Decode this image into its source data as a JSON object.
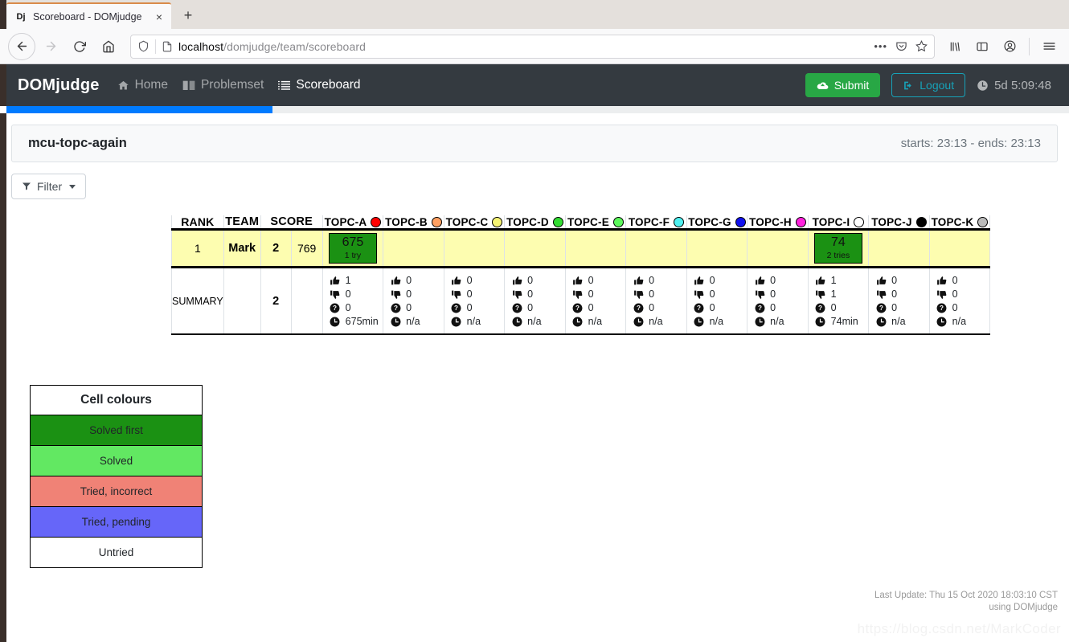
{
  "browser": {
    "tab": {
      "favicon_text": "Dj",
      "title": "Scoreboard - DOMjudge",
      "close_label": "×"
    },
    "new_tab_label": "+",
    "url_host": "localhost",
    "url_path": "/domjudge/team/scoreboard",
    "icons": {
      "back": "back-arrow-icon",
      "forward": "forward-arrow-icon",
      "reload": "reload-icon",
      "home": "home-icon",
      "shield": "shield-icon",
      "page": "page-icon",
      "ellipsis": "•••",
      "pocket": "pocket-icon",
      "star": "star-icon",
      "library": "library-icon",
      "sidebar": "sidebar-icon",
      "account": "account-icon",
      "menu": "hamburger-menu-icon"
    }
  },
  "navbar": {
    "brand": "DOMjudge",
    "links": [
      {
        "label": "Home",
        "icon": "home-icon",
        "active": false
      },
      {
        "label": "Problemset",
        "icon": "book-icon",
        "active": false
      },
      {
        "label": "Scoreboard",
        "icon": "list-icon",
        "active": true
      }
    ],
    "submit_label": "Submit",
    "logout_label": "Logout",
    "clock_text": "5d 5:09:48",
    "accent_submit": "#28a745",
    "accent_logout": "#17a2b8",
    "background": "#343a40"
  },
  "progress": {
    "percent": 25,
    "color": "#007bff"
  },
  "contest": {
    "name": "mcu-topc-again",
    "times": "starts: 23:13 - ends: 23:13"
  },
  "filter": {
    "label": "Filter"
  },
  "scoreboard": {
    "headers": {
      "rank": "RANK",
      "team": "TEAM",
      "score": "SCORE"
    },
    "problems": [
      {
        "label": "TOPC-A",
        "color": "#ff0000"
      },
      {
        "label": "TOPC-B",
        "color": "#ffa062"
      },
      {
        "label": "TOPC-C",
        "color": "#f6f473"
      },
      {
        "label": "TOPC-D",
        "color": "#33dd33"
      },
      {
        "label": "TOPC-E",
        "color": "#5cf85c"
      },
      {
        "label": "TOPC-F",
        "color": "#4ff0f0"
      },
      {
        "label": "TOPC-G",
        "color": "#1111ee"
      },
      {
        "label": "TOPC-H",
        "color": "#ff22dd"
      },
      {
        "label": "TOPC-I",
        "color": "#ffffff"
      },
      {
        "label": "TOPC-J",
        "color": "#000000"
      },
      {
        "label": "TOPC-K",
        "color": "#bbbbbb"
      }
    ],
    "rows": [
      {
        "rank": "1",
        "team": "Mark",
        "solved": "2",
        "penalty": "769",
        "cells": [
          {
            "state": "first",
            "time": "675",
            "tries": "1 try"
          },
          {
            "state": "untried",
            "time": "",
            "tries": ""
          },
          {
            "state": "untried",
            "time": "",
            "tries": ""
          },
          {
            "state": "untried",
            "time": "",
            "tries": ""
          },
          {
            "state": "untried",
            "time": "",
            "tries": ""
          },
          {
            "state": "untried",
            "time": "",
            "tries": ""
          },
          {
            "state": "untried",
            "time": "",
            "tries": ""
          },
          {
            "state": "untried",
            "time": "",
            "tries": ""
          },
          {
            "state": "first",
            "time": "74",
            "tries": "2 tries"
          },
          {
            "state": "untried",
            "time": "",
            "tries": ""
          },
          {
            "state": "untried",
            "time": "",
            "tries": ""
          }
        ]
      }
    ],
    "summary": {
      "label": "Summary",
      "solved": "2",
      "columns": [
        {
          "correct": "1",
          "incorrect": "0",
          "pending": "0",
          "avg": "675min"
        },
        {
          "correct": "0",
          "incorrect": "0",
          "pending": "0",
          "avg": "n/a"
        },
        {
          "correct": "0",
          "incorrect": "0",
          "pending": "0",
          "avg": "n/a"
        },
        {
          "correct": "0",
          "incorrect": "0",
          "pending": "0",
          "avg": "n/a"
        },
        {
          "correct": "0",
          "incorrect": "0",
          "pending": "0",
          "avg": "n/a"
        },
        {
          "correct": "0",
          "incorrect": "0",
          "pending": "0",
          "avg": "n/a"
        },
        {
          "correct": "0",
          "incorrect": "0",
          "pending": "0",
          "avg": "n/a"
        },
        {
          "correct": "0",
          "incorrect": "0",
          "pending": "0",
          "avg": "n/a"
        },
        {
          "correct": "1",
          "incorrect": "1",
          "pending": "0",
          "avg": "74min"
        },
        {
          "correct": "0",
          "incorrect": "0",
          "pending": "0",
          "avg": "n/a"
        },
        {
          "correct": "0",
          "incorrect": "0",
          "pending": "0",
          "avg": "n/a"
        }
      ]
    }
  },
  "legend": {
    "title": "Cell colours",
    "rows": [
      {
        "label": "Solved first",
        "color": "#1b9113"
      },
      {
        "label": "Solved",
        "color": "#62e862"
      },
      {
        "label": "Tried, incorrect",
        "color": "#f08276"
      },
      {
        "label": "Tried, pending",
        "color": "#6666f9"
      },
      {
        "label": "Untried",
        "color": "#ffffff"
      }
    ]
  },
  "footer": {
    "last_update": "Last Update: Thu 15 Oct 2020 18:03:10 CST",
    "using": "using DOMjudge",
    "watermark": "https://blog.csdn.net/MarkCoder"
  }
}
